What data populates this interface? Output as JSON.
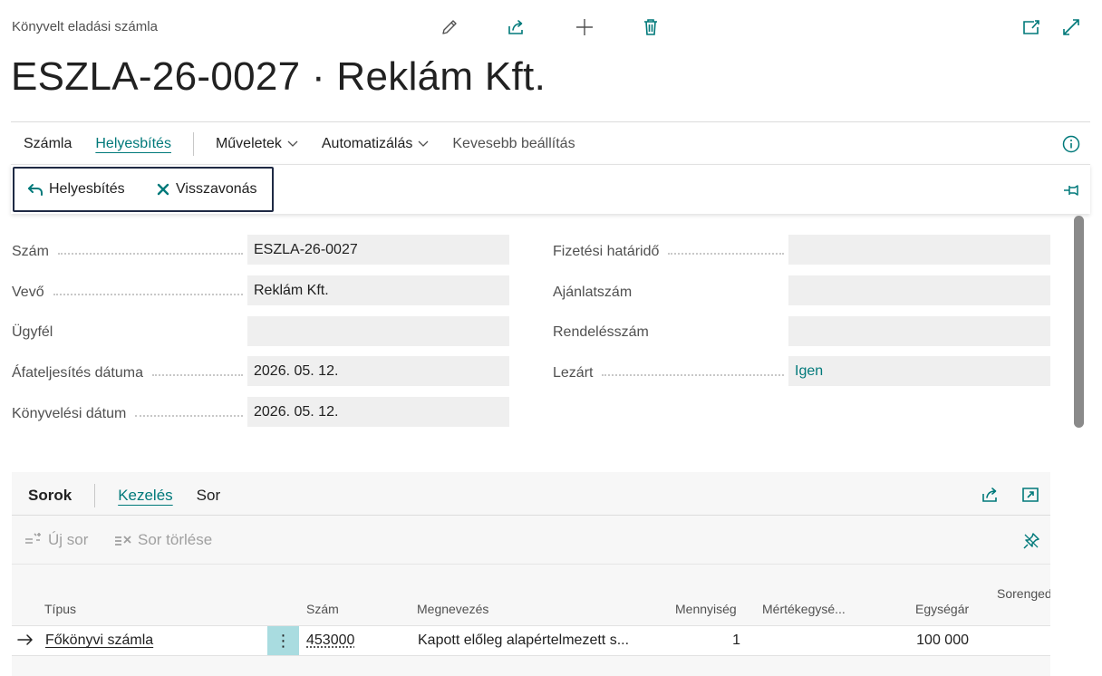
{
  "header": {
    "breadcrumb": "Könyvelt eladási számla",
    "title": "ESZLA-26-0027 · Reklám Kft.",
    "icons": [
      "edit-icon",
      "share-icon",
      "add-icon",
      "delete-icon",
      "open-new-window-icon",
      "expand-icon"
    ]
  },
  "tabs": [
    {
      "label": "Számla",
      "active": false
    },
    {
      "label": "Helyesbítés",
      "active": true
    },
    {
      "label": "Műveletek",
      "dropdown": true
    },
    {
      "label": "Automatizálás",
      "dropdown": true
    },
    {
      "label": "Kevesebb beállítás"
    }
  ],
  "actions": {
    "correct_label": "Helyesbítés",
    "cancel_label": "Visszavonás"
  },
  "fields": {
    "left": [
      {
        "label": "Szám",
        "value": "ESZLA-26-0027"
      },
      {
        "label": "Vevő",
        "value": "Reklám Kft."
      },
      {
        "label": "Ügyfél",
        "value": ""
      },
      {
        "label": "Áfateljesítés dátuma",
        "value": "2026. 05. 12."
      },
      {
        "label": "Könyvelési dátum",
        "value": "2026. 05. 12."
      }
    ],
    "right": [
      {
        "label": "Fizetési határidő",
        "value": ""
      },
      {
        "label": "Ajánlatszám",
        "value": ""
      },
      {
        "label": "Rendelésszám",
        "value": ""
      },
      {
        "label": "Lezárt",
        "value": "Igen"
      }
    ]
  },
  "lines": {
    "title": "Sorok",
    "tabs": [
      "Kezelés",
      "Sor"
    ],
    "new_line_label": "Új sor",
    "delete_line_label": "Sor törlése",
    "columns": [
      "Típus",
      "Szám",
      "Megnevezés",
      "Mennyiség",
      "Mértékegysé...",
      "Egységár",
      "Sorenged"
    ],
    "rows": [
      {
        "type": "Főkönyvi számla",
        "number": "453000",
        "description": "Kapott előleg alapértelmezett s...",
        "quantity": "1",
        "unit": "",
        "unit_price": "100 000"
      }
    ]
  },
  "colors": {
    "accent": "#00797a",
    "focus_border": "#1f2a44",
    "field_bg": "#efefef",
    "row_menu_bg": "#a9dce0"
  }
}
